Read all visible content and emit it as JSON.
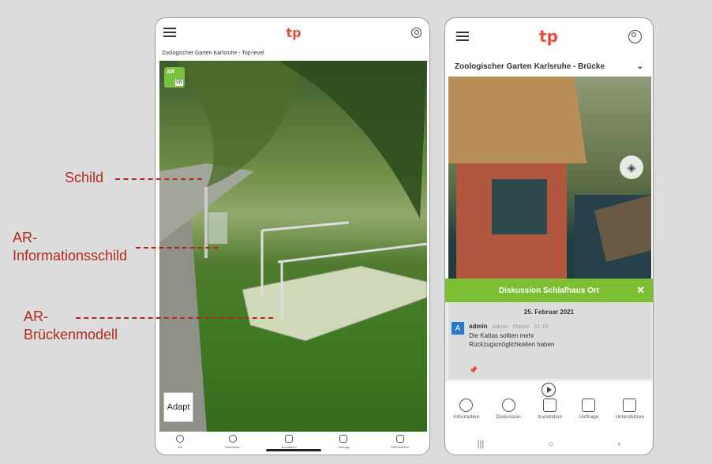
{
  "annotations": {
    "sign": "Schild",
    "ar_info_sign_line1": "AR-",
    "ar_info_sign_line2": "Informationsschild",
    "ar_bridge_line1": "AR-",
    "ar_bridge_line2": "Brückenmodell"
  },
  "left_phone": {
    "logo": "tp",
    "breadcrumb": "Zoologischer Garten Karlsruhe -  Top-level",
    "arvr": {
      "ar": "AR",
      "vr": "VR"
    },
    "adapt_button": "Adapt",
    "tabs": [
      {
        "label": "Info",
        "icon": "info-icon"
      },
      {
        "label": "Diskussion",
        "icon": "chat-icon"
      },
      {
        "label": "Annotation",
        "icon": "annotation-icon"
      },
      {
        "label": "Umfrage",
        "icon": "survey-icon"
      },
      {
        "label": "Unterstützen",
        "icon": "support-icon"
      }
    ]
  },
  "right_phone": {
    "logo": "tp",
    "breadcrumb": "Zoologischer Garten Karlsruhe -  Brücke",
    "discussion": {
      "title": "Diskussion Schlafhaus Ort",
      "date": "25. Februar 2021",
      "comment": {
        "avatar_letter": "A",
        "user": "admin",
        "role": "Admin",
        "badge": "Owner",
        "time": "21:18",
        "text_line1": "Die Kattas sollten mehr",
        "text_line2": "Rückzugsmöglichkeiten haben"
      }
    },
    "tabs": [
      {
        "label": "Information",
        "icon": "info-icon"
      },
      {
        "label": "Diskussion",
        "icon": "chat-icon"
      },
      {
        "label": "Annotation",
        "icon": "annotation-icon"
      },
      {
        "label": "Umfrage",
        "icon": "survey-icon"
      },
      {
        "label": "Unterstützen",
        "icon": "support-icon"
      }
    ],
    "android_nav": {
      "recent": "|||",
      "home": "○",
      "back": "‹"
    }
  }
}
